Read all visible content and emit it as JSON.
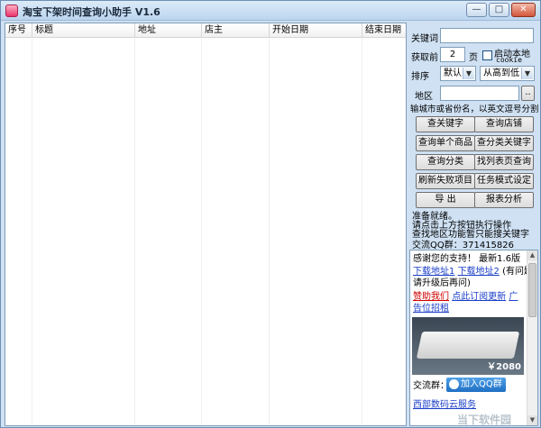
{
  "window": {
    "title": "淘宝下架时间查询小助手 V1.6",
    "min_glyph": "—",
    "max_glyph": "□",
    "close_glyph": "✕"
  },
  "list": {
    "columns": [
      "序号",
      "标题",
      "地址",
      "店主",
      "开始日期",
      "结束日期"
    ],
    "rows": []
  },
  "panel": {
    "keyword_label": "关键词",
    "keyword_value": "",
    "pages_label": "获取前",
    "pages_value": "2",
    "pages_unit": "页",
    "autostart_label": "启动本地",
    "autostart_sub": "cookie",
    "sort_label": "排序",
    "sort_value": "默认",
    "order_value": "从高到低",
    "region_label": "地区",
    "region_value": "",
    "region_browse": "..",
    "region_hint": "输城市或省份名，以英文逗号分割",
    "buttons": [
      "查关键字",
      "查询店铺",
      "查询单个商品",
      "查分类关键字",
      "查询分类",
      "找列表页查询",
      "刷新失败项目",
      "任务模式设定",
      "导  出",
      "报表分析"
    ],
    "status_lines": [
      "准备就绪。",
      "请点击上方按钮执行操作",
      "查找地区功能暂只能搜关键字"
    ],
    "qq_group": "交流QQ群：371415826"
  },
  "ad": {
    "line1": "感谢您的支持！ 最新1.6版",
    "link1": "下载地址1",
    "link2": "下载地址2",
    "note": "(有问题",
    "note2": "请升级后再问)",
    "sponsor": "赞助我们",
    "subscribe": "点此订阅更新",
    "adspace": "广",
    "adspace2": "告位招租",
    "price": "￥2080",
    "qq_label": "交流群：",
    "qq_button": "加入QQ群",
    "bottom": "西部数码云服务"
  },
  "watermark": "当下软件园"
}
